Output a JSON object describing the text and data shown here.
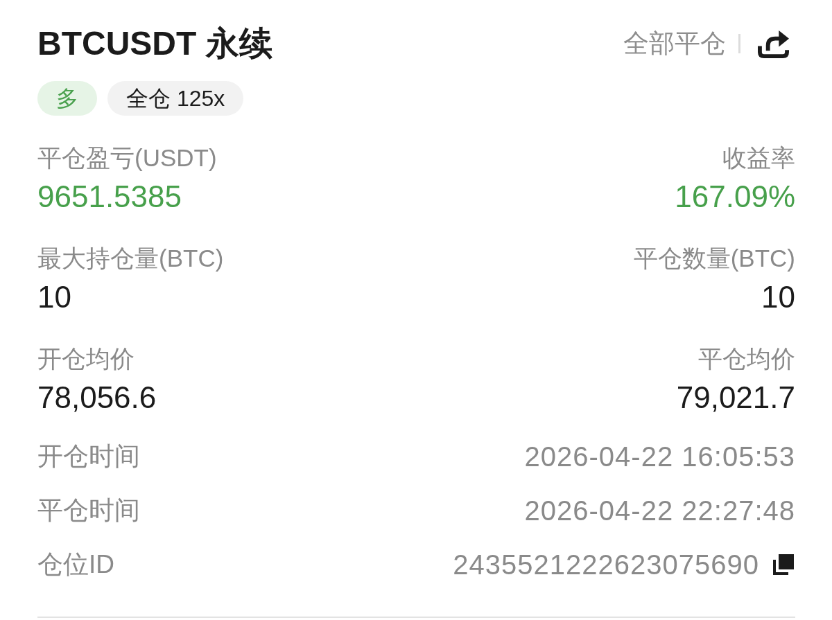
{
  "header": {
    "title": "BTCUSDT 永续",
    "close_all": "全部平仓"
  },
  "tags": [
    {
      "label": "多",
      "kind": "side"
    },
    {
      "label": "全仓 125x",
      "kind": "margin"
    }
  ],
  "stats": [
    {
      "label": "平仓盈亏(USDT)",
      "value": "9651.5385",
      "kind": "gain"
    },
    {
      "label": "收益率",
      "value": "167.09%",
      "kind": "gain"
    },
    {
      "label": "最大持仓量(BTC)",
      "value": "10",
      "kind": "plain"
    },
    {
      "label": "平仓数量(BTC)",
      "value": "10",
      "kind": "plain"
    },
    {
      "label": "开仓均价",
      "value": "78,056.6",
      "kind": "plain"
    },
    {
      "label": "平仓均价",
      "value": "79,021.7",
      "kind": "plain"
    }
  ],
  "details": [
    {
      "label": "开仓时间",
      "value": "2026-04-22 16:05:53",
      "copyable": false
    },
    {
      "label": "平仓时间",
      "value": "2026-04-22 22:27:48",
      "copyable": false
    },
    {
      "label": "仓位ID",
      "value": "2435521222623075690",
      "copyable": true
    }
  ]
}
